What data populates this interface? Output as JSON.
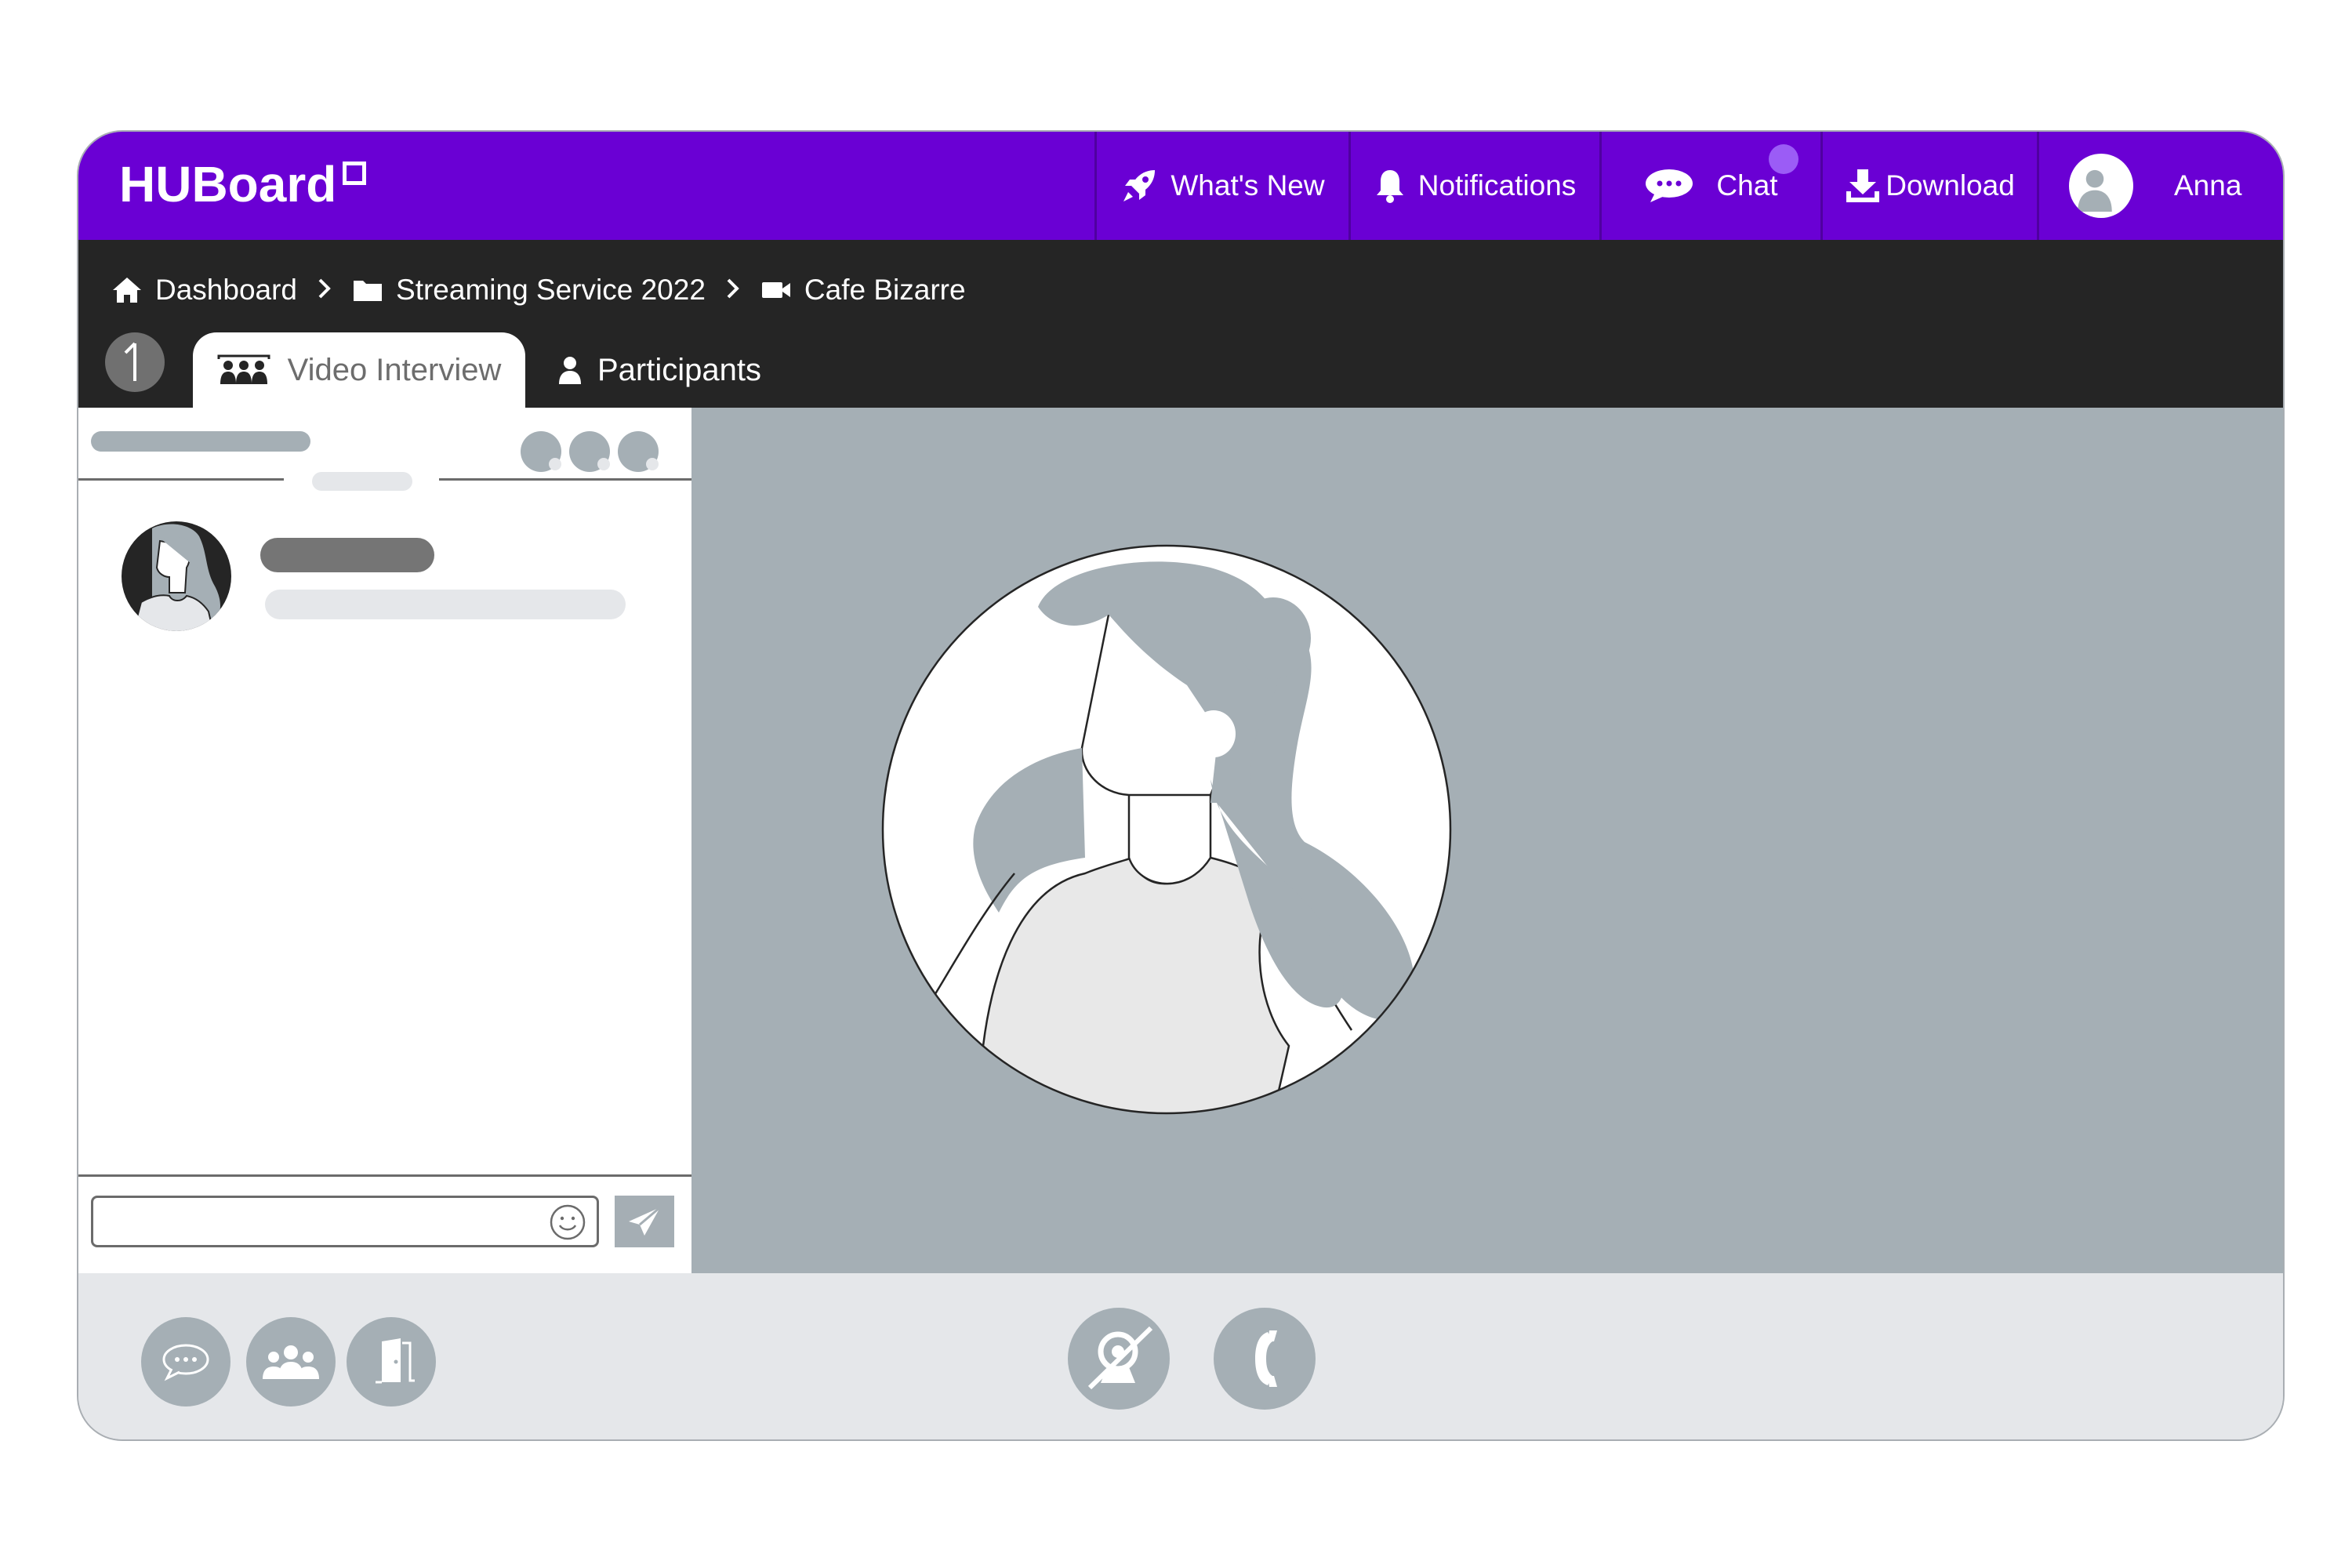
{
  "app": {
    "name": "HUBoard"
  },
  "nav": {
    "whats_new": "What's New",
    "notifications": "Notifications",
    "chat": "Chat",
    "download": "Download",
    "user_name": "Anna"
  },
  "breadcrumb": {
    "items": [
      {
        "label": "Dashboard",
        "icon": "home-icon"
      },
      {
        "label": "Streaming Service 2022",
        "icon": "folder-icon"
      },
      {
        "label": "Cafe Bizarre",
        "icon": "video-camera-icon"
      }
    ]
  },
  "tabs": {
    "active": "Video Interview",
    "second": "Participants"
  },
  "chat": {
    "input_value": "",
    "input_placeholder": ""
  },
  "colors": {
    "brand": "#6a00d4",
    "dark_bar": "#252525",
    "video_bg": "#a5afb5",
    "control_bg": "#e5e7ea",
    "notification_dot": "#9b5cf6"
  },
  "icons": {
    "controls_left": [
      "chat-bubble-icon",
      "participants-icon",
      "exit-door-icon"
    ],
    "controls_center": [
      "camera-off-icon",
      "phone-icon"
    ]
  }
}
